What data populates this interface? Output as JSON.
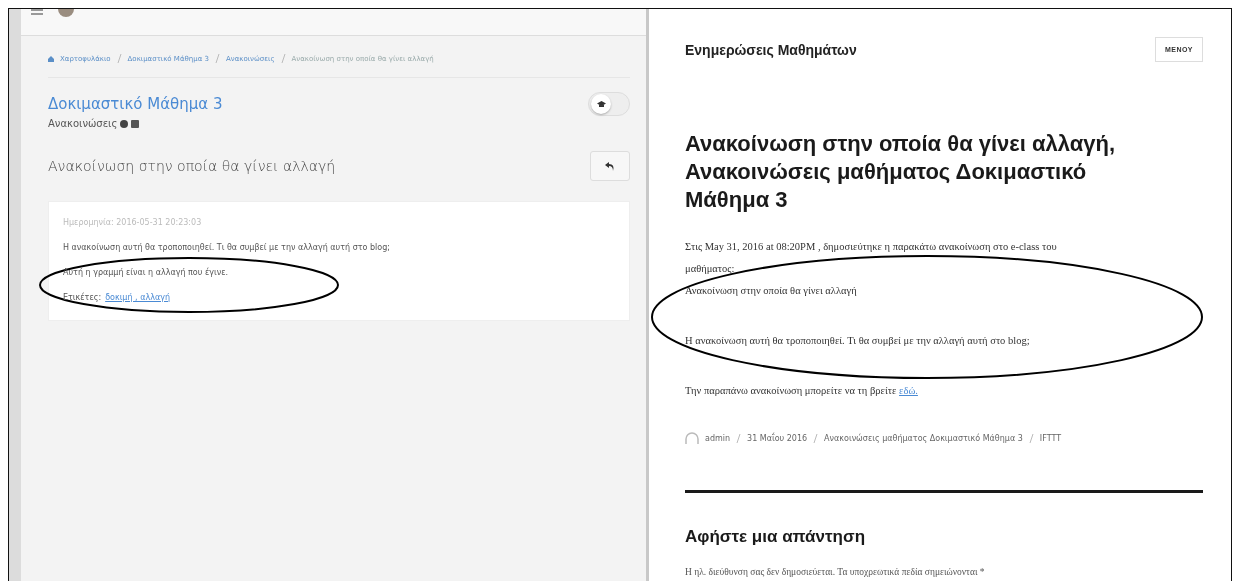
{
  "left": {
    "breadcrumb": [
      "Χαρτοφυλάκιο",
      "Δοκιμαστικό Μάθημα 3",
      "Ανακοινώσεις",
      "Ανακοίνωση στην οποία θα γίνει αλλαγή"
    ],
    "course_title": "Δοκιμαστικό Μάθημα 3",
    "section": "Ανακοινώσεις",
    "toggle": {
      "on": false
    },
    "announcement_title": "Ανακοίνωση στην οποία θα γίνει αλλαγή",
    "card": {
      "date": "Ημερομηνία: 2016-05-31 20:23:03",
      "body": "Η ανακοίνωση αυτή θα τροποποιηθεί. Τι θα συμβεί με την αλλαγή αυτή στο blog;",
      "changed_line": "Αυτή η γραμμή είναι η αλλαγή που έγινε.",
      "tags_label": "Ετικέτες:",
      "tags": "δοκιμή , αλλαγή"
    }
  },
  "right": {
    "site_title": "Ενημερώσεις Μαθημάτων",
    "menu_button": "ΜΕΝΟΥ",
    "post_title": "Ανακοίνωση στην οποία θα γίνει αλλαγή, Ανακοινώσεις μαθήματος Δοκιμαστικό Μάθημα 3",
    "intro": "Στις May 31, 2016 at 08:20PM , δημοσιεύτηκε η παρακάτω ανακοίνωση στο e-class του μαθήματος:",
    "quoted_title": "Ανακοίνωση στην οποία θα γίνει αλλαγή",
    "body": "Η ανακοίνωση αυτή θα τροποποιηθεί. Τι θα συμβεί με την αλλαγή αυτή στο blog;",
    "more_text": "Την παραπάνω ανακοίνωση μπορείτε να τη βρείτε",
    "more_link": "εδώ.",
    "meta": [
      "admin",
      "31 Μαΐου 2016",
      "Ανακοινώσεις μαθήματος Δοκιμαστικό Μάθημα 3",
      "IFTTT"
    ],
    "reply_heading": "Αφήστε μια απάντηση",
    "reply_note": "Η ηλ. διεύθυνση σας δεν δημοσιεύεται. Τα υποχρεωτικά πεδία σημειώνονται *"
  }
}
